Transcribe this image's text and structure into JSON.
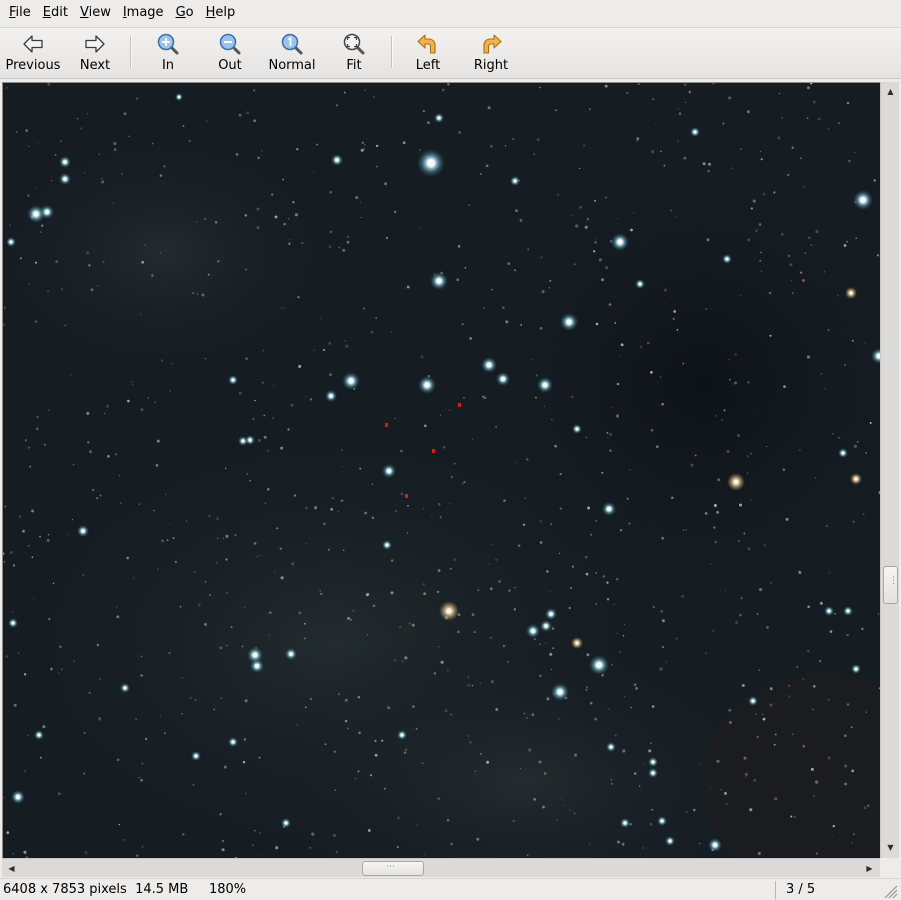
{
  "menu": [
    {
      "label": "File",
      "mnemonic": "F",
      "rest": "ile"
    },
    {
      "label": "Edit",
      "mnemonic": "E",
      "rest": "dit"
    },
    {
      "label": "View",
      "mnemonic": "V",
      "rest": "iew"
    },
    {
      "label": "Image",
      "mnemonic": "I",
      "rest": "mage"
    },
    {
      "label": "Go",
      "mnemonic": "G",
      "rest": "o"
    },
    {
      "label": "Help",
      "mnemonic": "H",
      "rest": "elp"
    }
  ],
  "toolbar": {
    "previous": {
      "label": "Previous",
      "icon": "arrow-left-icon"
    },
    "next": {
      "label": "Next",
      "icon": "arrow-right-icon"
    },
    "zoom_in": {
      "label": "In",
      "icon": "zoom-in-icon"
    },
    "zoom_out": {
      "label": "Out",
      "icon": "zoom-out-icon"
    },
    "zoom_normal": {
      "label": "Normal",
      "icon": "zoom-normal-icon"
    },
    "zoom_fit": {
      "label": "Fit",
      "icon": "zoom-fit-icon"
    },
    "rotate_left": {
      "label": "Left",
      "icon": "rotate-left-icon"
    },
    "rotate_right": {
      "label": "Right",
      "icon": "rotate-right-icon"
    }
  },
  "image": {
    "description_colors": {
      "background": "#131a20",
      "star": "#e8f6ff",
      "star_halo": "#7fd6e8",
      "warm_star": "#f3d9a8"
    }
  },
  "status": {
    "dimensions": "6408 x 7853 pixels",
    "size": "14.5 MB",
    "zoom": "180%",
    "page": "3 / 5"
  },
  "scroll": {
    "vertical_position": 0.63,
    "horizontal_position": 0.41
  },
  "colors": {
    "chrome": "#edeceb",
    "icon_blue": "#4a79b6",
    "icon_orange": "#e8a23a"
  }
}
